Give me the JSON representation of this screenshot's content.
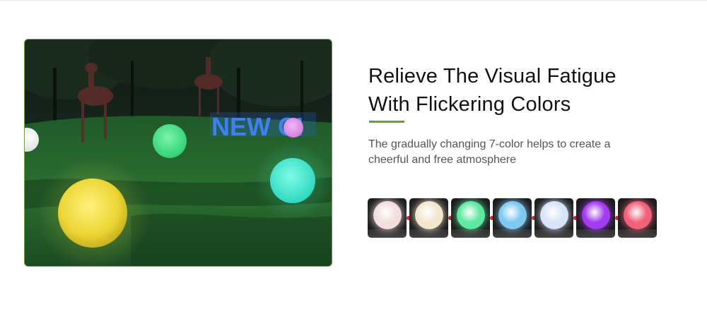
{
  "headline": {
    "line1": "Relieve The Visual Fatigue",
    "line2": "With Flickering Colors"
  },
  "subtext": {
    "line1": "The gradually changing 7-color helps to create a",
    "line2": "cheerful and free atmosphere"
  },
  "photo": {
    "sign_text": "NEW CI"
  },
  "colors": {
    "accent": "#5aa62e",
    "arrow": "#d8261e",
    "swatches": [
      "#f3dedd",
      "#f3e6cf",
      "#5fe8a0",
      "#7ec8f2",
      "#d7e4f8",
      "#a23cf0",
      "#f2607a"
    ]
  }
}
